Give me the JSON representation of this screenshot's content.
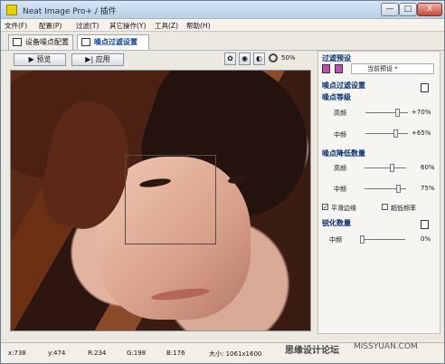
{
  "window": {
    "title": "Neat Image Pro+ / 插件",
    "buttons": {
      "minimize": "—",
      "maximize": "□",
      "close": "X"
    }
  },
  "menu": [
    "文件(F)",
    "配置(P)",
    "过滤(T)",
    "其它操作(Y)",
    "工具(Z)",
    "帮助(H)"
  ],
  "tabs": [
    {
      "label": "设备噪点配置",
      "active": false
    },
    {
      "label": "噪点过滤设置",
      "active": true
    }
  ],
  "toolbar": {
    "preview": "预览",
    "apply": "应用",
    "zoom": "50%"
  },
  "panel": {
    "filter_preset": "过滤预设",
    "current_preset": "当前预设 *",
    "noise_filter_settings": "噪点过滤设置",
    "noise_level": "噪点等级",
    "rows": [
      {
        "label": "高频",
        "value": "+70%",
        "level": 0.7
      },
      {
        "label": "中频",
        "value": "+65%",
        "level": 0.65
      }
    ],
    "noise_reduction_amount": "噪点降低数量",
    "reduction_rows": [
      {
        "label": "高频",
        "value": "60%",
        "level": 0.6
      },
      {
        "label": "中频",
        "value": "75%",
        "level": 0.75
      }
    ],
    "smooth_edges": "平滑边缘",
    "high_freq": "超低频率",
    "sharpening_amount": "锐化数量",
    "sharpen_row": {
      "label": "中频",
      "value": "0%",
      "level": 0
    }
  },
  "status": {
    "x": "x:738",
    "y": "y:474",
    "r": "R:234",
    "g": "G:198",
    "b": "B:176",
    "size": "大小: 1061x1600"
  },
  "watermark": {
    "text": "思缘设计论坛",
    "site": "MISSYUAN.COM"
  }
}
